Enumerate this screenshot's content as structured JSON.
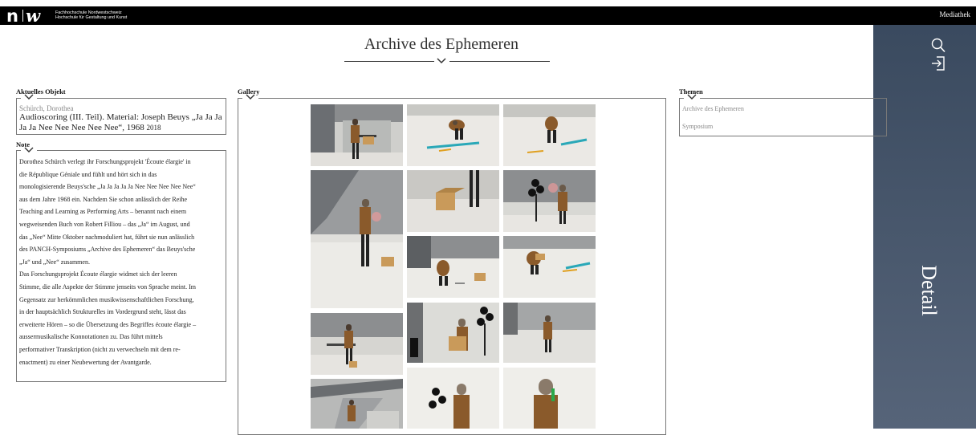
{
  "topbar": {
    "logo_n": "n",
    "logo_w": "w",
    "logo_line1": "Fachhochschule Nordwestschweiz",
    "logo_line2": "Hochschule für Gestaltung und Kunst",
    "mediathek": "Mediathek"
  },
  "page": {
    "title": "Archive des Ephemeren"
  },
  "sidebar": {
    "search_icon": "search-icon",
    "login_icon": "login-icon",
    "detail_label": "Detail",
    "bg_color": "#4a586c"
  },
  "current_object": {
    "label": "Aktuelles Objekt",
    "author": "Schürch, Dorothea",
    "title": "Audioscoring (III. Teil). Material: Joseph Beuys „Ja Ja Ja Ja Ja Nee Nee Nee Nee Nee“, 1968",
    "year": "2018"
  },
  "note": {
    "label": "Note",
    "lines": [
      "Dorothea Schürch verlegt ihr Forschungsprojekt 'Écoute élargie' in",
      "die République Géniale und fühlt und hört sich in das",
      "monologisierende Beuys'sche „Ja Ja Ja Ja Ja Nee Nee Nee Nee Nee“",
      "aus dem Jahre 1968 ein. Nachdem Sie schon anlässlich der Reihe",
      "Teaching and Learning as Performing Arts – benannt nach einem",
      "wegweisenden Buch von Robert Filliou – das „Ja“ im August, und",
      "das „Nee“ Mitte Oktober nachmoduliert hat, führt sie nun anlässlich",
      "des PANCH-Symposiums „Archive des Ephemeren“ das Beuys'sche",
      "„Ja“ und „Nee“ zusammen.",
      "Das Forschungsprojekt Écoute élargie widmet sich der leeren",
      "Stimme, die alle Aspekte der Stimme jenseits von Sprache meint. Im",
      "Gegensatz zur herkömmlichen musikwissenschaftlichen Forschung,",
      "in der hauptsächlich Strukturelles im Vordergrund steht, lässt das",
      "erweiterte Hören – so die Übersetzung des Begriffes écoute élargie –",
      "aussermusikalische Konnotationen zu. Das führt mittels",
      "performativer Transkription (nicht zu verwechseln mit dem re-",
      "enactment) zu einer Neubewertung der Avantgarde."
    ]
  },
  "gallery": {
    "label": "Gallery",
    "thumbs": [
      "performer-at-table-photo",
      "performer-crouching-floor-photo",
      "performer-bending-floor-photo",
      "performer-standing-tall-photo",
      "cardboard-box-legs-photo",
      "performer-speaker-stand-photo",
      "performer-kneeling-box-photo",
      "performer-crouching-papers-photo",
      "performer-table-wide-photo",
      "performer-box-speakers-photo",
      "performer-standing-far-photo",
      "staircase-performer-photo",
      "performer-closeup-speakers-photo",
      "performer-closeup-object-photo"
    ]
  },
  "themes": {
    "label": "Themen",
    "items": [
      "Archive des Ephemeren",
      "Symposium"
    ]
  }
}
